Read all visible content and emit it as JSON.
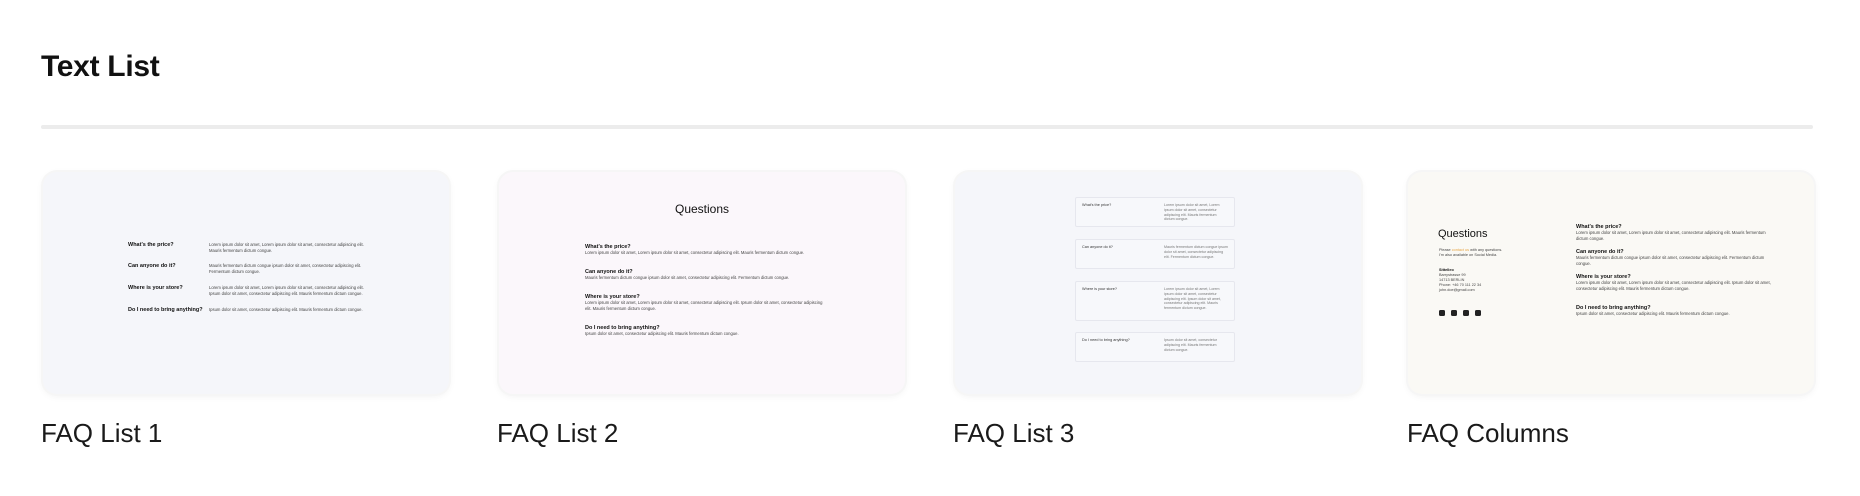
{
  "section": {
    "title": "Text List"
  },
  "cards": [
    {
      "label": "FAQ List 1",
      "faq": [
        {
          "q": "What's the price?",
          "a": "Lorem ipsum dolor sit amet, Lorem ipsum dolor sit amet, consectetur adipiscing elit. Mauris fermentum dictum congue."
        },
        {
          "q": "Can anyone do it?",
          "a": "Mauris fermentum dictum congue ipsum dolor sit amet, consectetur adipiscing elit. Fermentum dictum congue."
        },
        {
          "q": "Where is your store?",
          "a": "Lorem ipsum dolor sit amet, Lorem ipsum dolor sit amet, consectetur adipiscing elit. Ipsum dolor sit amet, consectetur adipiscing elit. Mauris fermentum dictum congue."
        },
        {
          "q": "Do I need to bring anything?",
          "a": "Ipsum dolor sit amet, consectetur adipiscing elit. Mauris fermentum dictum congue."
        }
      ]
    },
    {
      "label": "FAQ List 2",
      "heading": "Questions",
      "faq": [
        {
          "q": "What's the price?",
          "a": "Lorem ipsum dolor sit amet, Lorem ipsum dolor sit amet, consectetur adipiscing elit. Mauris fermentum dictum congue."
        },
        {
          "q": "Can anyone do it?",
          "a": "Mauris fermentum dictum congue ipsum dolor sit amet, consectetur adipiscing elit. Fermentum dictum congue."
        },
        {
          "q": "Where is your store?",
          "a": "Lorem ipsum dolor sit amet, Lorem ipsum dolor sit amet, consectetur adipiscing elit. Ipsum dolor sit amet, consectetur adipiscing elit. Mauris fermentum dictum congue."
        },
        {
          "q": "Do I need to bring anything?",
          "a": "Ipsum dolor sit amet, consectetur adipiscing elit. Mauris fermentum dictum congue."
        }
      ]
    },
    {
      "label": "FAQ List 3",
      "faq": [
        {
          "q": "What's the price?",
          "a": "Lorem ipsum dolor sit amet, Lorem ipsum dolor sit amet, consectetur adipiscing elit. Mauris fermentum dictum congue."
        },
        {
          "q": "Can anyone do it?",
          "a": "Mauris fermentum dictum congue ipsum dolor sit amet, consectetur adipiscing elit. Fermentum dictum congue."
        },
        {
          "q": "Where is your store?",
          "a": "Lorem ipsum dolor sit amet, Lorem ipsum dolor sit amet, consectetur adipiscing elit. Ipsum dolor sit amet, consectetur adipiscing elit. Mauris fermentum dictum congue."
        },
        {
          "q": "Do I need to bring anything?",
          "a": "Ipsum dolor sit amet, consectetur adipiscing elit. Mauris fermentum dictum congue."
        }
      ]
    },
    {
      "label": "FAQ Columns",
      "heading": "Questions",
      "intro_before": "Please",
      "intro_link": "contact us",
      "intro_after": "with any questions.",
      "intro_line2": "I'm also available on Social Media.",
      "company": "Sittelleo",
      "address": "Barrystrasse 99",
      "postcode": "14713 BERLIN",
      "phone": "Phone: +46 70 111 22 34",
      "email": "john.doe@gmail.com",
      "socials": [
        "twitter-icon",
        "instagram-icon",
        "facebook-icon",
        "linkedin-icon"
      ],
      "faq": [
        {
          "q": "What's the price?",
          "a": "Lorem ipsum dolor sit amet, Lorem ipsum dolor sit amet, consectetur adipiscing elit. Mauris fermentum dictum congue."
        },
        {
          "q": "Can anyone do it?",
          "a": "Mauris fermentum dictum congue ipsum dolor sit amet, consectetur adipiscing elit. Fermentum dictum congue."
        },
        {
          "q": "Where is your store?",
          "a": "Lorem ipsum dolor sit amet, Lorem ipsum dolor sit amet, consectetur adipiscing elit. Ipsum dolor sit amet, consectetur adipiscing elit. Mauris fermentum dictum congue."
        },
        {
          "q": "Do I need to bring anything?",
          "a": "Ipsum dolor sit amet, consectetur adipiscing elit. Mauris fermentum dictum congue."
        }
      ]
    }
  ]
}
